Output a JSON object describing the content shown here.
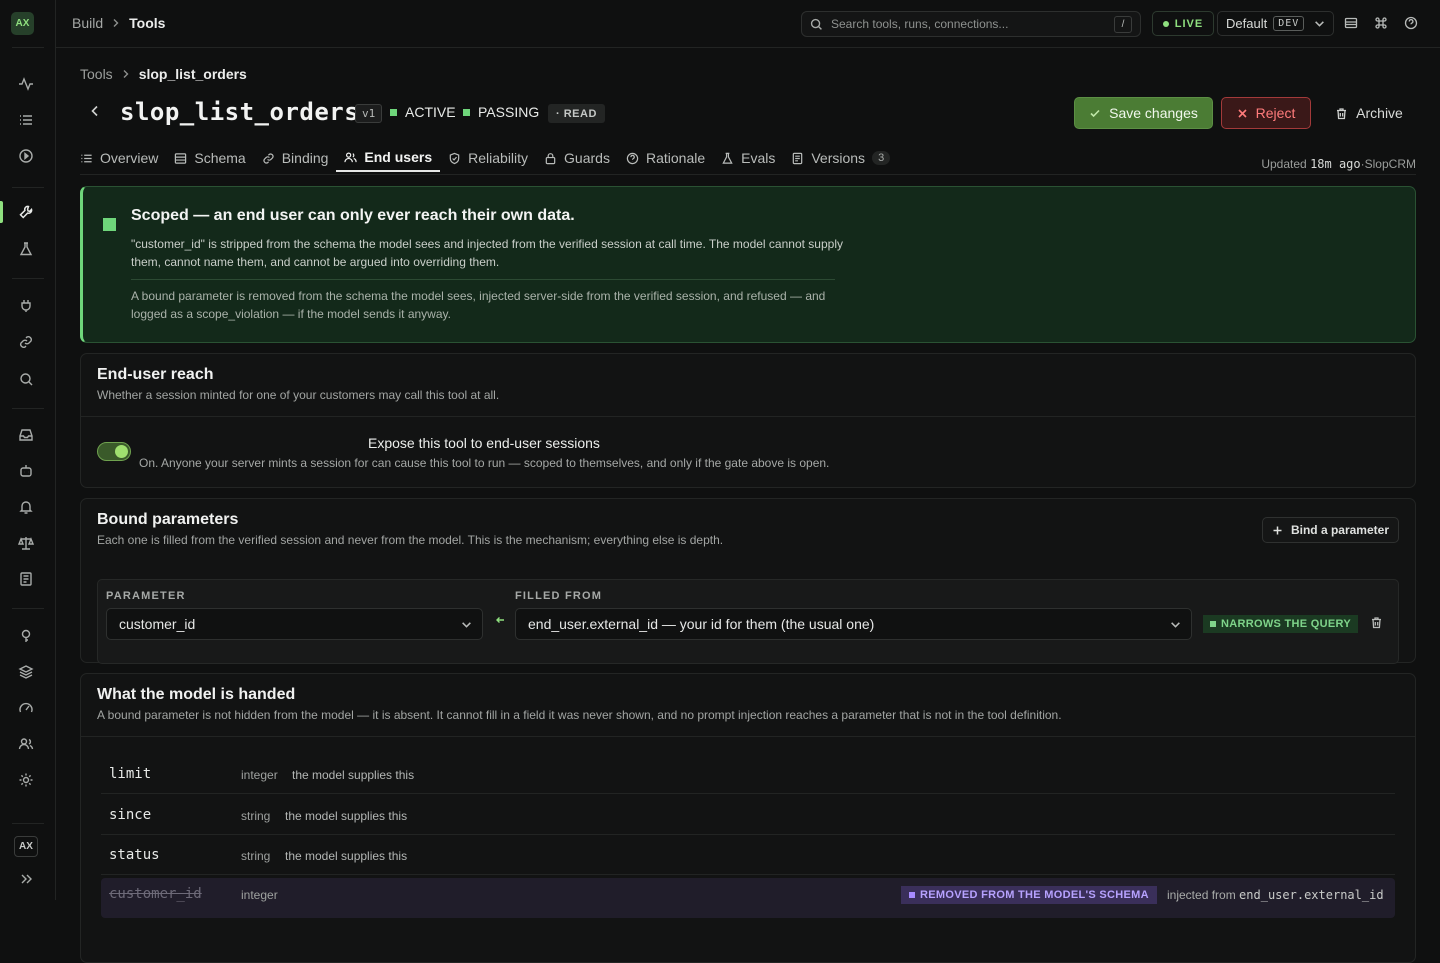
{
  "rail": {
    "logo": "AX",
    "footer_badge": "AX"
  },
  "topbar": {
    "crumb_root": "Build",
    "crumb_current": "Tools",
    "search_placeholder": "Search tools, runs, connections...",
    "search_shortcut": "/",
    "live_label": "LIVE",
    "env_name": "Default",
    "env_tag": "DEV"
  },
  "page": {
    "crumb_root": "Tools",
    "crumb_current": "slop_list_orders",
    "tool_name": "slop_list_orders",
    "version": "v1",
    "status_active": "ACTIVE",
    "status_passing": "PASSING",
    "access": "· READ",
    "save_label": "Save changes",
    "reject_label": "Reject",
    "archive_label": "Archive",
    "updated_prefix": "Updated",
    "updated_time": "18m ago",
    "updated_sep": "·",
    "updated_source": "SlopCRM"
  },
  "tabs": [
    {
      "label": "Overview",
      "icon": "list-icon"
    },
    {
      "label": "Schema",
      "icon": "table-icon"
    },
    {
      "label": "Binding",
      "icon": "link-icon"
    },
    {
      "label": "End users",
      "icon": "users-icon",
      "active": true
    },
    {
      "label": "Reliability",
      "icon": "shield-icon"
    },
    {
      "label": "Guards",
      "icon": "lock-icon"
    },
    {
      "label": "Rationale",
      "icon": "help-circle-icon"
    },
    {
      "label": "Evals",
      "icon": "flask-icon"
    },
    {
      "label": "Versions",
      "icon": "file-icon",
      "count": "3"
    }
  ],
  "hero": {
    "title": "Scoped — an end user can only ever reach their own data.",
    "body": "\"customer_id\" is stripped from the schema the model sees and injected from the verified session at call time. The model cannot supply them, cannot name them, and cannot be argued into overriding them.",
    "note": "A bound parameter is removed from the schema the model sees, injected server-side from the verified session, and refused — and logged as a scope_violation — if the model sends it anyway."
  },
  "reach": {
    "title": "End-user reach",
    "subtitle": "Whether a session minted for one of your customers may call this tool at all.",
    "toggle_on": true,
    "toggle_label": "Expose this tool to end-user sessions",
    "toggle_desc": "On. Anyone your server mints a session for can cause this tool to run — scoped to themselves, and only if the gate above is open."
  },
  "bound": {
    "title": "Bound parameters",
    "subtitle": "Each one is filled from the verified session and never from the model. This is the mechanism; everything else is depth.",
    "bind_button": "Bind a parameter",
    "col_parameter": "PARAMETER",
    "col_filled_from": "FILLED FROM",
    "parameter_value": "customer_id",
    "filled_from_value": "end_user.external_id — your id for them (the usual one)",
    "badge": "NARROWS THE QUERY"
  },
  "handed": {
    "title": "What the model is handed",
    "subtitle": "A bound parameter is not hidden from the model — it is absent. It cannot fill in a field it was never shown, and no prompt injection reaches a parameter that is not in the tool definition.",
    "rows": [
      {
        "name": "limit",
        "type": "integer",
        "desc": "the model supplies this"
      },
      {
        "name": "since",
        "type": "string",
        "desc": "the model supplies this"
      },
      {
        "name": "status",
        "type": "string",
        "desc": "the model supplies this"
      }
    ],
    "removed_row": {
      "name": "customer_id",
      "type": "integer",
      "badge": "REMOVED FROM THE MODEL'S SCHEMA",
      "injected_prefix": "injected from",
      "injected_source": "end_user.external_id"
    }
  },
  "colors": {
    "accent_green": "#6fd67b",
    "save_bg": "#4b7c34",
    "reject_border": "#a33a3a",
    "removed_purple": "#a78bff"
  }
}
